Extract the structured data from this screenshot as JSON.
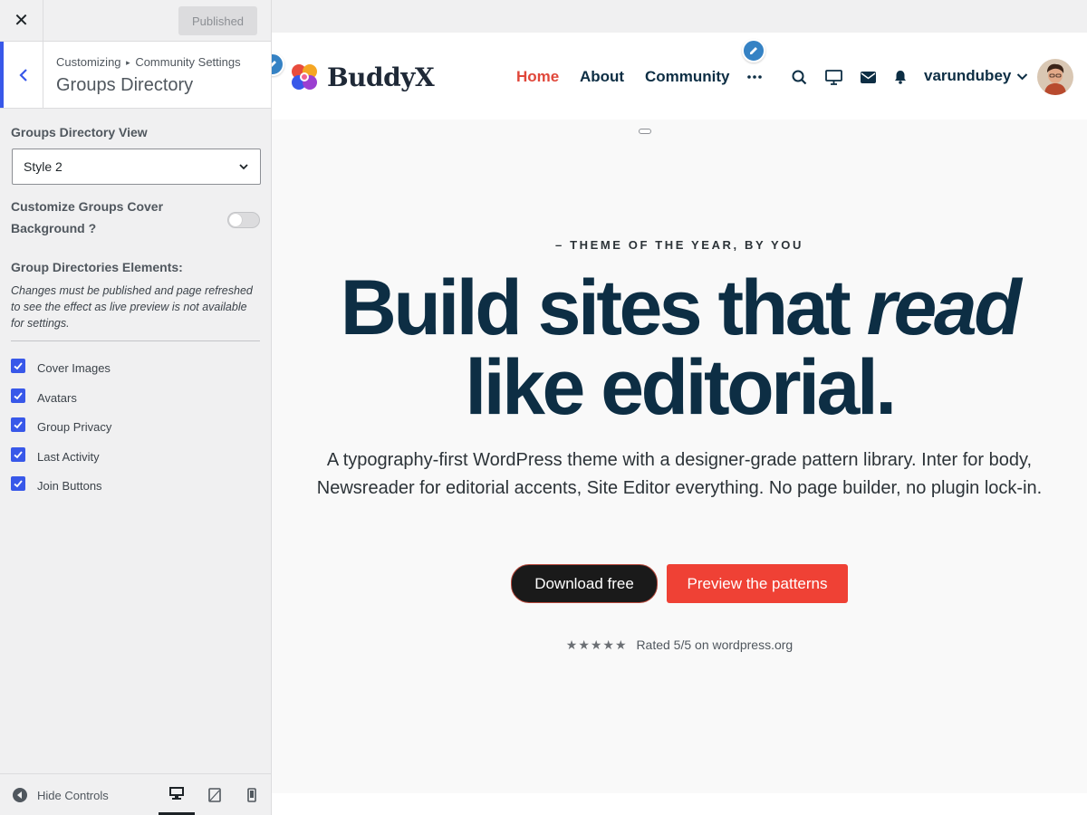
{
  "sidebar": {
    "publish_label": "Published",
    "breadcrumb_root": "Customizing",
    "breadcrumb_section": "Community Settings",
    "title": "Groups Directory",
    "directory_view_label": "Groups Directory View",
    "directory_view_value": "Style 2",
    "cover_bg_label": "Customize Groups Cover Background ?",
    "cover_bg_enabled": false,
    "elements_label": "Group Directories Elements:",
    "elements_desc": "Changes must be published and page refreshed to see the effect as live preview is not available for settings.",
    "elements": [
      {
        "label": "Cover Images",
        "checked": true
      },
      {
        "label": "Avatars",
        "checked": true
      },
      {
        "label": "Group Privacy",
        "checked": true
      },
      {
        "label": "Last Activity",
        "checked": true
      },
      {
        "label": "Join Buttons",
        "checked": true
      }
    ],
    "hide_controls_label": "Hide Controls",
    "accent_color": "#3858e9"
  },
  "preview": {
    "logo_text": "BuddyX",
    "nav": [
      {
        "label": "Home",
        "active": true
      },
      {
        "label": "About",
        "active": false
      },
      {
        "label": "Community",
        "active": false
      }
    ],
    "username": "varundubey",
    "eyebrow": "– THEME OF THE YEAR, BY YOU",
    "headline_part1": "Build sites that ",
    "headline_italic": "read",
    "headline_part2": "like editorial.",
    "subtext": "A typography-first WordPress theme with a designer-grade pattern library. Inter for body, Newsreader for editorial accents, Site Editor everything. No page builder, no plugin lock-in.",
    "primary_button": "Download free",
    "secondary_button": "Preview the patterns",
    "stars": "★★★★★",
    "rating_text": "Rated 5/5 on wordpress.org",
    "nav_color": "#0d2e44",
    "active_nav_color": "#e0473a",
    "cta_color": "#ef4135"
  }
}
